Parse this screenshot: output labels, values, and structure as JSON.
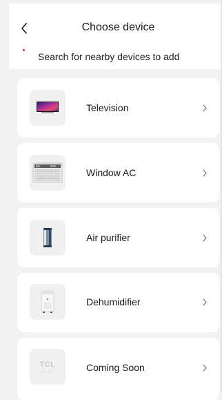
{
  "header": {
    "back_icon": "chevron-left-icon",
    "title": "Choose device",
    "search_hint": "Search for nearby devices to add",
    "hint_dot_color": "#e0242d"
  },
  "devices": [
    {
      "label": "Television",
      "icon": "television-icon",
      "chevron_icon": "chevron-right-icon"
    },
    {
      "label": "Window AC",
      "icon": "window-ac-icon",
      "chevron_icon": "chevron-right-icon"
    },
    {
      "label": "Air purifier",
      "icon": "air-purifier-icon",
      "chevron_icon": "chevron-right-icon"
    },
    {
      "label": "Dehumidifier",
      "icon": "dehumidifier-icon",
      "chevron_icon": "chevron-right-icon"
    },
    {
      "label": "Coming Soon",
      "icon": "tcl-home-logo-icon",
      "chevron_icon": "chevron-right-icon"
    }
  ],
  "tcl_logo": {
    "brand": "TCL",
    "sub": "HOME"
  }
}
